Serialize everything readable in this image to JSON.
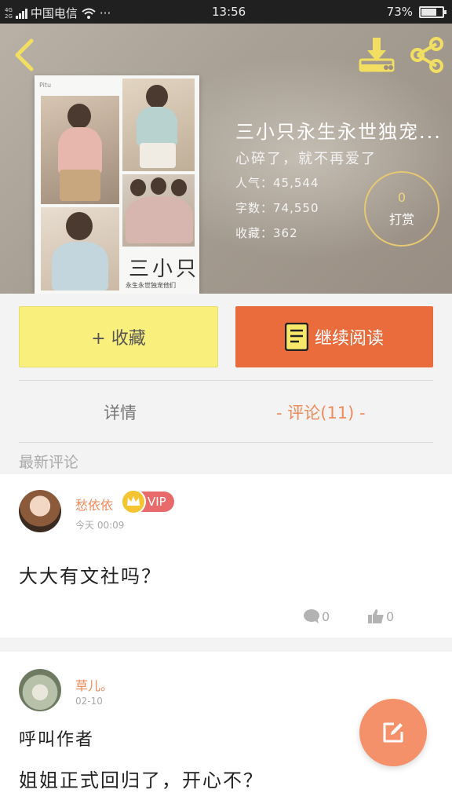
{
  "status_bar": {
    "carrier": "中国电信",
    "net_top": "4G",
    "net_bottom": "2G",
    "more": "···",
    "time": "13:56",
    "battery": "73%",
    "battery_level": 0.73
  },
  "book": {
    "cover_tag": "Pitu",
    "cover_title": "三小只",
    "cover_subtitle": "永生永世独宠他们",
    "title": "三小只永生永世独宠...",
    "description": "心碎了，就不再爱了",
    "popularity": "人气：45,544",
    "word_count": "字数：74,550",
    "favorites": "收藏：362",
    "reward_count": "0",
    "reward_label": "打赏"
  },
  "actions": {
    "favorite_label": "+ 收藏",
    "continue_label": "继续阅读"
  },
  "tabs": {
    "details": "详情",
    "comments": "- 评论(11) -"
  },
  "comments_section": {
    "label": "最新评论",
    "items": [
      {
        "user": "愁依依",
        "badge": "VIP",
        "time": "今天 00:09",
        "text": "大大有文社吗？",
        "replies": "0",
        "likes": "0"
      },
      {
        "user": "草儿。",
        "time": "02-10",
        "text_line1": "呼叫作者",
        "text_line2": "姐姐正式回归了，开心不？"
      }
    ]
  },
  "colors": {
    "accent": "#ea6c3d",
    "favorite_button": "#f9ef7d",
    "username": "#ef8a5a",
    "vip": "#e86a6a",
    "fab": "#f4916a",
    "icon_yellow": "#f2df62"
  }
}
